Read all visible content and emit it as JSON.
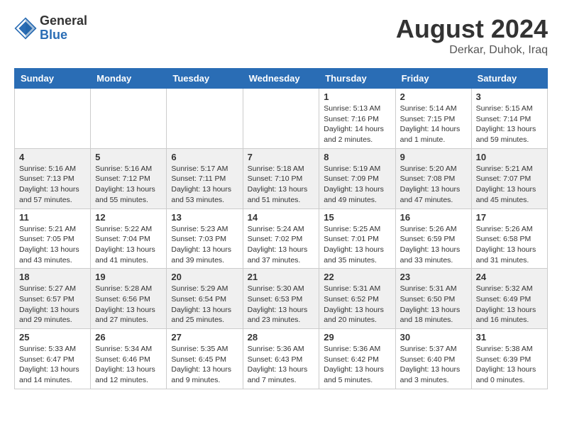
{
  "header": {
    "logo_general": "General",
    "logo_blue": "Blue",
    "month_year": "August 2024",
    "location": "Derkar, Duhok, Iraq"
  },
  "weekdays": [
    "Sunday",
    "Monday",
    "Tuesday",
    "Wednesday",
    "Thursday",
    "Friday",
    "Saturday"
  ],
  "weeks": [
    [
      {
        "day": "",
        "info": ""
      },
      {
        "day": "",
        "info": ""
      },
      {
        "day": "",
        "info": ""
      },
      {
        "day": "",
        "info": ""
      },
      {
        "day": "1",
        "info": "Sunrise: 5:13 AM\nSunset: 7:16 PM\nDaylight: 14 hours\nand 2 minutes."
      },
      {
        "day": "2",
        "info": "Sunrise: 5:14 AM\nSunset: 7:15 PM\nDaylight: 14 hours\nand 1 minute."
      },
      {
        "day": "3",
        "info": "Sunrise: 5:15 AM\nSunset: 7:14 PM\nDaylight: 13 hours\nand 59 minutes."
      }
    ],
    [
      {
        "day": "4",
        "info": "Sunrise: 5:16 AM\nSunset: 7:13 PM\nDaylight: 13 hours\nand 57 minutes."
      },
      {
        "day": "5",
        "info": "Sunrise: 5:16 AM\nSunset: 7:12 PM\nDaylight: 13 hours\nand 55 minutes."
      },
      {
        "day": "6",
        "info": "Sunrise: 5:17 AM\nSunset: 7:11 PM\nDaylight: 13 hours\nand 53 minutes."
      },
      {
        "day": "7",
        "info": "Sunrise: 5:18 AM\nSunset: 7:10 PM\nDaylight: 13 hours\nand 51 minutes."
      },
      {
        "day": "8",
        "info": "Sunrise: 5:19 AM\nSunset: 7:09 PM\nDaylight: 13 hours\nand 49 minutes."
      },
      {
        "day": "9",
        "info": "Sunrise: 5:20 AM\nSunset: 7:08 PM\nDaylight: 13 hours\nand 47 minutes."
      },
      {
        "day": "10",
        "info": "Sunrise: 5:21 AM\nSunset: 7:07 PM\nDaylight: 13 hours\nand 45 minutes."
      }
    ],
    [
      {
        "day": "11",
        "info": "Sunrise: 5:21 AM\nSunset: 7:05 PM\nDaylight: 13 hours\nand 43 minutes."
      },
      {
        "day": "12",
        "info": "Sunrise: 5:22 AM\nSunset: 7:04 PM\nDaylight: 13 hours\nand 41 minutes."
      },
      {
        "day": "13",
        "info": "Sunrise: 5:23 AM\nSunset: 7:03 PM\nDaylight: 13 hours\nand 39 minutes."
      },
      {
        "day": "14",
        "info": "Sunrise: 5:24 AM\nSunset: 7:02 PM\nDaylight: 13 hours\nand 37 minutes."
      },
      {
        "day": "15",
        "info": "Sunrise: 5:25 AM\nSunset: 7:01 PM\nDaylight: 13 hours\nand 35 minutes."
      },
      {
        "day": "16",
        "info": "Sunrise: 5:26 AM\nSunset: 6:59 PM\nDaylight: 13 hours\nand 33 minutes."
      },
      {
        "day": "17",
        "info": "Sunrise: 5:26 AM\nSunset: 6:58 PM\nDaylight: 13 hours\nand 31 minutes."
      }
    ],
    [
      {
        "day": "18",
        "info": "Sunrise: 5:27 AM\nSunset: 6:57 PM\nDaylight: 13 hours\nand 29 minutes."
      },
      {
        "day": "19",
        "info": "Sunrise: 5:28 AM\nSunset: 6:56 PM\nDaylight: 13 hours\nand 27 minutes."
      },
      {
        "day": "20",
        "info": "Sunrise: 5:29 AM\nSunset: 6:54 PM\nDaylight: 13 hours\nand 25 minutes."
      },
      {
        "day": "21",
        "info": "Sunrise: 5:30 AM\nSunset: 6:53 PM\nDaylight: 13 hours\nand 23 minutes."
      },
      {
        "day": "22",
        "info": "Sunrise: 5:31 AM\nSunset: 6:52 PM\nDaylight: 13 hours\nand 20 minutes."
      },
      {
        "day": "23",
        "info": "Sunrise: 5:31 AM\nSunset: 6:50 PM\nDaylight: 13 hours\nand 18 minutes."
      },
      {
        "day": "24",
        "info": "Sunrise: 5:32 AM\nSunset: 6:49 PM\nDaylight: 13 hours\nand 16 minutes."
      }
    ],
    [
      {
        "day": "25",
        "info": "Sunrise: 5:33 AM\nSunset: 6:47 PM\nDaylight: 13 hours\nand 14 minutes."
      },
      {
        "day": "26",
        "info": "Sunrise: 5:34 AM\nSunset: 6:46 PM\nDaylight: 13 hours\nand 12 minutes."
      },
      {
        "day": "27",
        "info": "Sunrise: 5:35 AM\nSunset: 6:45 PM\nDaylight: 13 hours\nand 9 minutes."
      },
      {
        "day": "28",
        "info": "Sunrise: 5:36 AM\nSunset: 6:43 PM\nDaylight: 13 hours\nand 7 minutes."
      },
      {
        "day": "29",
        "info": "Sunrise: 5:36 AM\nSunset: 6:42 PM\nDaylight: 13 hours\nand 5 minutes."
      },
      {
        "day": "30",
        "info": "Sunrise: 5:37 AM\nSunset: 6:40 PM\nDaylight: 13 hours\nand 3 minutes."
      },
      {
        "day": "31",
        "info": "Sunrise: 5:38 AM\nSunset: 6:39 PM\nDaylight: 13 hours\nand 0 minutes."
      }
    ]
  ]
}
